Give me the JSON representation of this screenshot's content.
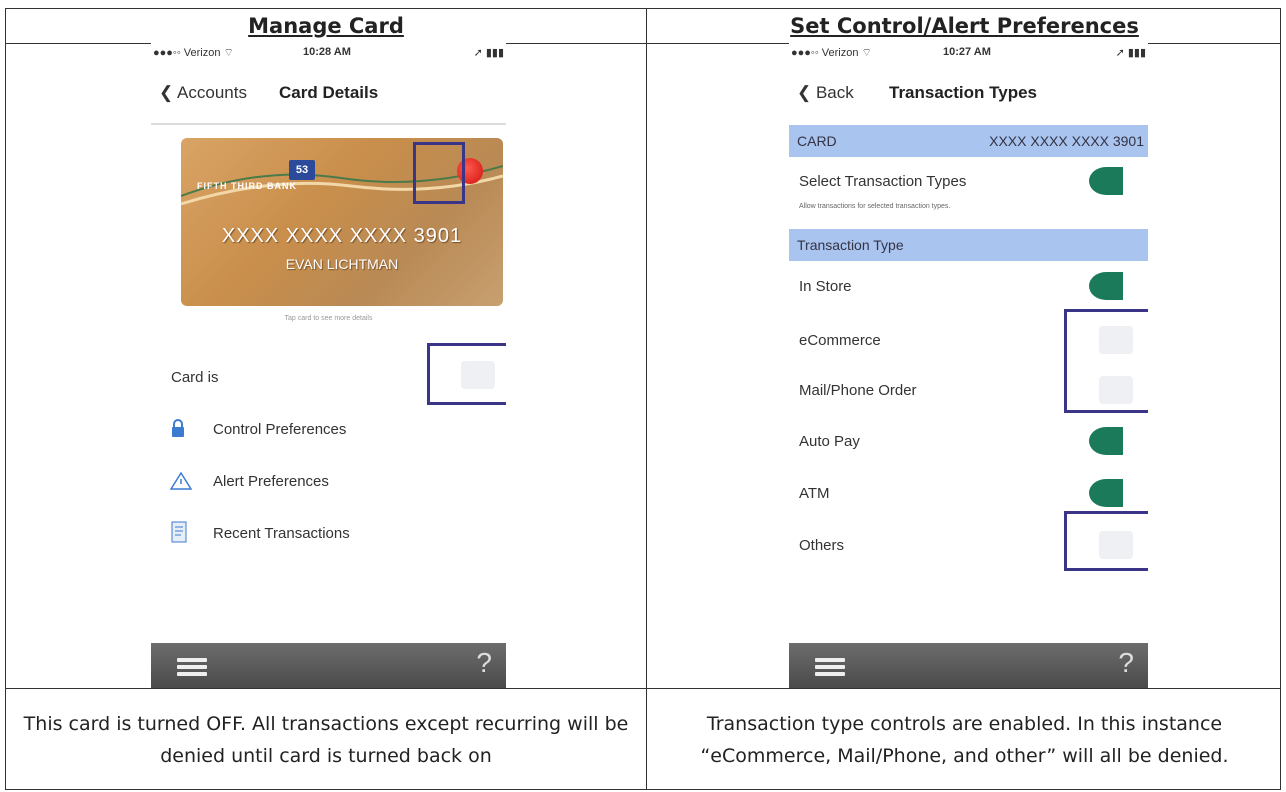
{
  "left": {
    "header": "Manage Card",
    "status": {
      "carrier": "●●●◦◦ Verizon ⌔",
      "time": "10:28 AM",
      "battery": "➚ ▮▮▮"
    },
    "nav": {
      "back": "❮ Accounts",
      "title": "Card Details"
    },
    "card": {
      "number": "XXXX XXXX XXXX 3901",
      "name": "EVAN LICHTMAN",
      "bank": "FIFTH THIRD BANK"
    },
    "hint": "Tap card to see more details",
    "card_status_label": "Card is",
    "menu": [
      {
        "label": "Control Preferences",
        "icon": "lock-icon"
      },
      {
        "label": "Alert Preferences",
        "icon": "warning-icon"
      },
      {
        "label": "Recent Transactions",
        "icon": "list-icon"
      }
    ],
    "help": "?",
    "caption": "This card is turned OFF. All transactions except recurring will be denied until card is turned back on"
  },
  "right": {
    "header": "Set Control/Alert Preferences",
    "status": {
      "carrier": "●●●◦◦ Verizon ⌔",
      "time": "10:27 AM",
      "battery": "➚ ▮▮▮"
    },
    "nav": {
      "back": "❮ Back",
      "title": "Transaction Types"
    },
    "card_row": {
      "label": "CARD",
      "value": "XXXX XXXX XXXX 3901"
    },
    "select_label": "Select Transaction Types",
    "select_sub": "Allow transactions for selected transaction types.",
    "section_label": "Transaction Type",
    "types": [
      {
        "label": "In Store",
        "enabled": true
      },
      {
        "label": "eCommerce",
        "enabled": false
      },
      {
        "label": "Mail/Phone Order",
        "enabled": false
      },
      {
        "label": "Auto Pay",
        "enabled": true
      },
      {
        "label": "ATM",
        "enabled": true
      },
      {
        "label": "Others",
        "enabled": false
      }
    ],
    "help": "?",
    "caption": "Transaction type controls are enabled. In this instance “eCommerce, Mail/Phone, and other” will all be denied."
  },
  "colors": {
    "toggle_on": "#1a7a5a",
    "highlight": "#3a3586",
    "section_blue": "#a9c4ee"
  }
}
